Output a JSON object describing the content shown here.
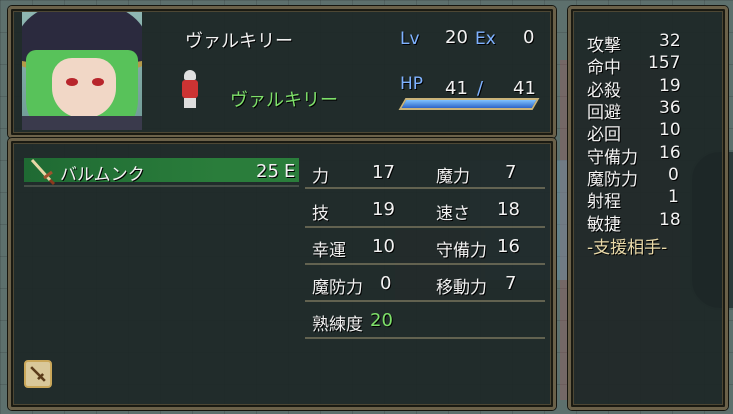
{
  "unit": {
    "name": "ヴァルキリー",
    "class": "ヴァルキリー",
    "lv_label": "Lv",
    "lv": "20",
    "ex_label": "Ex",
    "ex": "0",
    "hp_label": "HP",
    "hp_current": "41",
    "hp_sep": "/",
    "hp_max": "41",
    "hp_fraction": 1.0
  },
  "weapon": {
    "name": "バルムンク",
    "uses": "25",
    "equipped": "E"
  },
  "stats": [
    {
      "label": "力",
      "value": "17"
    },
    {
      "label": "魔力",
      "value": "7"
    },
    {
      "label": "技",
      "value": "19"
    },
    {
      "label": "速さ",
      "value": "18"
    },
    {
      "label": "幸運",
      "value": "10"
    },
    {
      "label": "守備力",
      "value": "16"
    },
    {
      "label": "魔防力",
      "value": "0"
    },
    {
      "label": "移動力",
      "value": "7"
    },
    {
      "label": "熟練度",
      "value": "20"
    }
  ],
  "combat": [
    {
      "label": "攻撃",
      "value": "32"
    },
    {
      "label": "命中",
      "value": "157"
    },
    {
      "label": "必殺",
      "value": "19"
    },
    {
      "label": "回避",
      "value": "36"
    },
    {
      "label": "必回",
      "value": "10"
    },
    {
      "label": "守備力",
      "value": "16"
    },
    {
      "label": "魔防力",
      "value": "0"
    },
    {
      "label": "射程",
      "value": "1"
    },
    {
      "label": "敏捷",
      "value": "18"
    }
  ],
  "support_label": "-支援相手-",
  "colors": {
    "frame": "#6b6149",
    "label_blue": "#7fb2ff",
    "highlight_green": "#7ee06a",
    "weapon_row": "#2a7d3b"
  },
  "icons": {
    "weapon": "sword-icon",
    "weapon_type": "sword-type-icon"
  }
}
